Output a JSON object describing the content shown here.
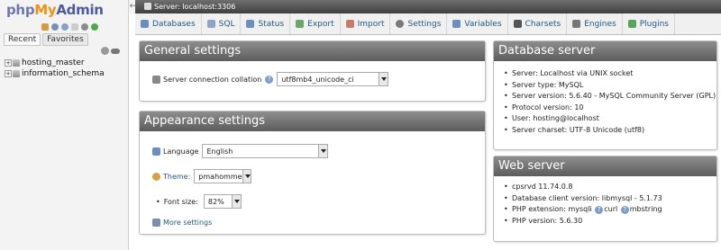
{
  "nav": {
    "logo": {
      "php": "php",
      "my": "My",
      "admin": "Admin"
    },
    "tabs": [
      "Recent",
      "Favorites"
    ],
    "tree": [
      "hosting_master",
      "information_schema"
    ]
  },
  "server_bar": {
    "label": "Server: localhost:3306"
  },
  "tabs": [
    {
      "label": "Databases",
      "icon": "databases-icon",
      "color": "#6b8dbd"
    },
    {
      "label": "SQL",
      "icon": "sql-icon",
      "color": "#8da5c7"
    },
    {
      "label": "Status",
      "icon": "status-icon",
      "color": "#6c8fbd"
    },
    {
      "label": "Export",
      "icon": "export-icon",
      "color": "#6aa56a"
    },
    {
      "label": "Import",
      "icon": "import-icon",
      "color": "#c97a6a"
    },
    {
      "label": "Settings",
      "icon": "settings-icon",
      "color": "#7a7a7a"
    },
    {
      "label": "Variables",
      "icon": "variables-icon",
      "color": "#6a8fc0"
    },
    {
      "label": "Charsets",
      "icon": "charsets-icon",
      "color": "#555555"
    },
    {
      "label": "Engines",
      "icon": "engines-icon",
      "color": "#777777"
    },
    {
      "label": "Plugins",
      "icon": "plugins-icon",
      "color": "#5aa55a"
    }
  ],
  "general": {
    "title": "General settings",
    "collation_label": "Server connection collation",
    "collation_value": "utf8mb4_unicode_ci"
  },
  "appearance": {
    "title": "Appearance settings",
    "language_label": "Language",
    "language_value": "English",
    "theme_label": "Theme:",
    "theme_value": "pmahomme",
    "fontsize_label": "Font size:",
    "fontsize_value": "82%",
    "more_settings": "More settings"
  },
  "db_server": {
    "title": "Database server",
    "items": [
      "Server: Localhost via UNIX socket",
      "Server type: MySQL",
      "Server version: 5.6.40 - MySQL Community Server (GPL)",
      "Protocol version: 10",
      "User: hosting@localhost",
      "Server charset: UTF-8 Unicode (utf8)"
    ]
  },
  "web_server": {
    "title": "Web server",
    "items": [
      "cpsrvd 11.74.0.8",
      "Database client version: libmysql - 5.1.73",
      "PHP version: 5.6.30"
    ],
    "php_ext_label": "PHP extension: mysqli",
    "php_ext_curl": "curl",
    "php_ext_mbstring": "mbstring"
  }
}
